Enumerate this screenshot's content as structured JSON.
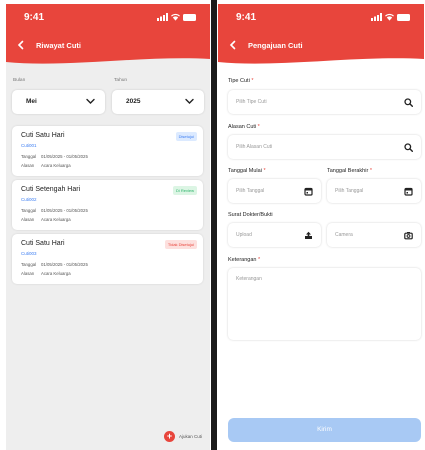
{
  "status": {
    "time": "9:41"
  },
  "left": {
    "title": "Riwayat Cuti",
    "filters": {
      "month_label": "Bulan",
      "month_value": "Mei",
      "year_label": "Tahun",
      "year_value": "2025"
    },
    "cards": [
      {
        "title": "Cuti Satu Hari",
        "code": "Cuti001",
        "date_key": "Tanggal",
        "date_val": "01/05/2025 - 01/05/2025",
        "reason_key": "Alasan",
        "reason_val": "Acara Keluarga",
        "status": "Disetujui"
      },
      {
        "title": "Cuti Setengah Hari",
        "code": "Cuti002",
        "date_key": "Tanggal",
        "date_val": "01/05/2025 - 01/05/2025",
        "reason_key": "Alasan",
        "reason_val": "Acara Keluarga",
        "status": "Di Review"
      },
      {
        "title": "Cuti Satu Hari",
        "code": "Cuti003",
        "date_key": "Tanggal",
        "date_val": "01/05/2025 - 01/05/2025",
        "reason_key": "Alasan",
        "reason_val": "Acara Keluarga",
        "status": "Tidak Disetujui"
      }
    ],
    "fab_label": "Ajukan Cuti"
  },
  "right": {
    "title": "Pengajuan Cuti",
    "leave_type": {
      "label": "Tipe Cuti",
      "required": "*",
      "placeholder": "Pilih Tipe Cuti",
      "icon": "search-icon"
    },
    "reason": {
      "label": "Alasan Cuti",
      "required": "*",
      "placeholder": "Pilih Alasan Cuti",
      "icon": "search-icon"
    },
    "start_date": {
      "label": "Tanggal Mulai",
      "required": "*",
      "placeholder": "Pilih Tanggal",
      "icon": "calendar-icon"
    },
    "end_date": {
      "label": "Tanggal Berakhir",
      "required": "*",
      "placeholder": "Pilih Tanggal",
      "icon": "calendar-icon"
    },
    "doc_label": "Surat Dokter/Bukti",
    "upload": {
      "placeholder": "Upload",
      "icon": "upload-icon"
    },
    "camera": {
      "placeholder": "Camera",
      "icon": "camera-icon"
    },
    "notes": {
      "label": "Keterangan",
      "required": "*",
      "placeholder": "Keterangan"
    },
    "submit_label": "Kirim"
  },
  "colors": {
    "accent": "#e8453c",
    "blue": "#3d7ef2",
    "green": "#2bb36a",
    "submit": "#a8c9f4"
  }
}
